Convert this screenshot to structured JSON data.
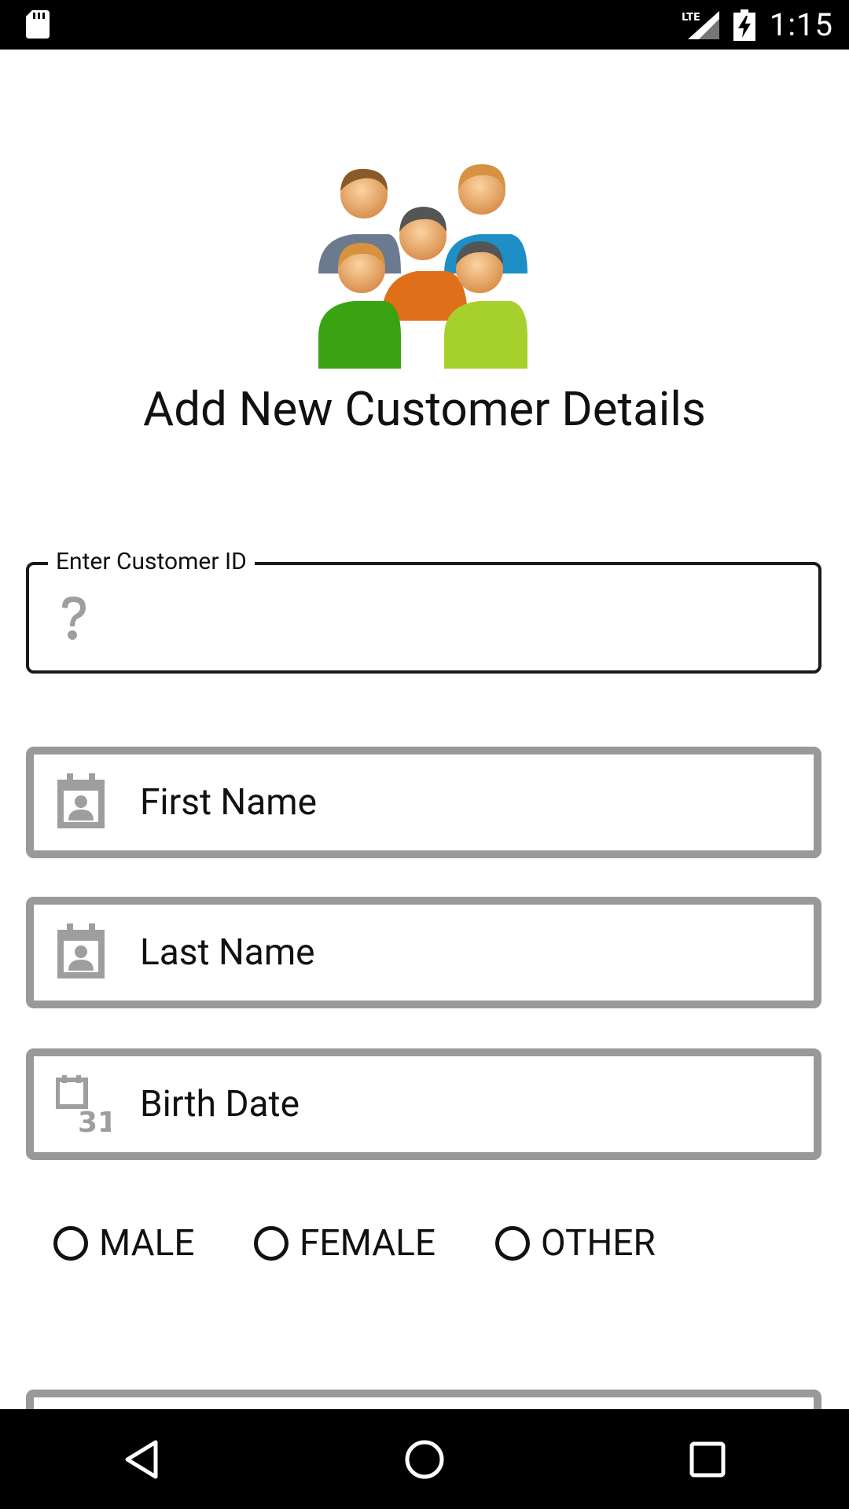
{
  "status_bar": {
    "time": "1:15",
    "network_label": "LTE"
  },
  "header": {
    "title": "Add New Customer Details"
  },
  "form": {
    "customer_id": {
      "label": "Enter Customer ID",
      "value": ""
    },
    "first_name": {
      "placeholder": "First Name"
    },
    "last_name": {
      "placeholder": "Last Name"
    },
    "birth_date": {
      "placeholder": "Birth Date",
      "icon_text": "31"
    },
    "gender": {
      "options": [
        "MALE",
        "FEMALE",
        "OTHER"
      ],
      "selected": null
    }
  },
  "colors": {
    "field_border_active": "#1a1a1a",
    "field_border_inactive": "#999999",
    "icon_gray": "#9e9e9e"
  }
}
